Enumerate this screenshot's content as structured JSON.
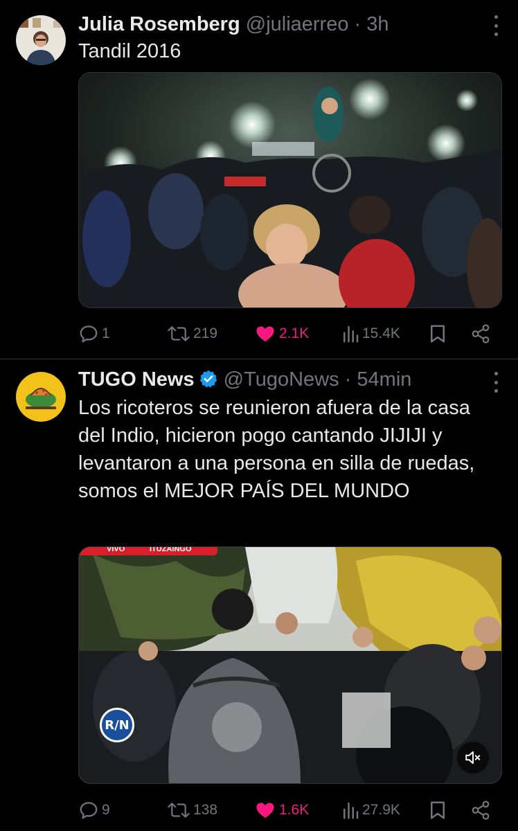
{
  "tweets": [
    {
      "author_name": "Julia Rosemberg",
      "handle": "@juliaerreo",
      "separator": " · ",
      "time": "3h",
      "text": "Tandil 2016",
      "replies": "1",
      "reposts": "219",
      "likes": "2.1K",
      "views": "15.4K",
      "liked": true
    },
    {
      "author_name": "TUGO News",
      "verified": true,
      "handle": "@TugoNews",
      "separator": " · ",
      "time": "54min",
      "text": "Los ricoteros se reunieron afuera de la casa del Indio, hicieron pogo cantando JIJIJI y levantaron a una persona en silla de ruedas, somos el MEJOR PAÍS DEL MUNDO",
      "video_overlay_live": "VIVO",
      "video_overlay_location": "ITUZAINGO",
      "video_logo": "R/N",
      "replies": "9",
      "reposts": "138",
      "likes": "1.6K",
      "views": "27.9K",
      "liked": true
    }
  ],
  "colors": {
    "background": "#000000",
    "text_primary": "#e7e9ea",
    "text_secondary": "#71767b",
    "like": "#f91880",
    "verified": "#1d9bf0",
    "divider": "#2f3336"
  },
  "icons": [
    "reply-icon",
    "repost-icon",
    "heart-icon",
    "views-icon",
    "bookmark-icon",
    "share-icon",
    "more-icon",
    "verified-icon",
    "mute-icon"
  ]
}
